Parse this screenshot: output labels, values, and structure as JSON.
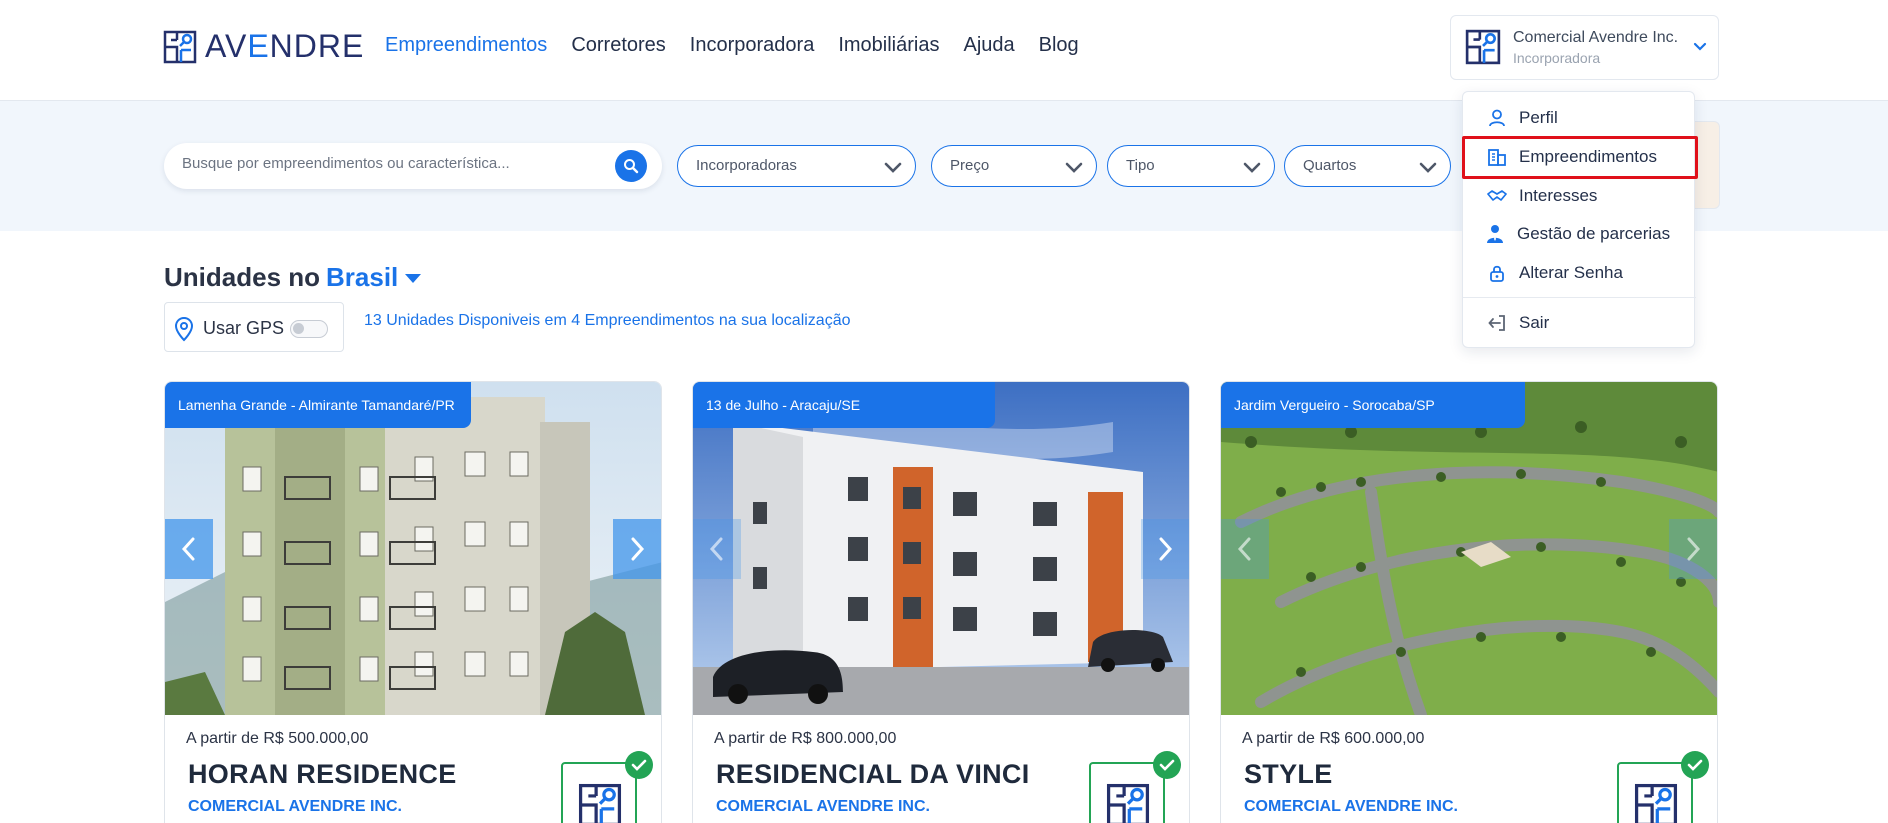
{
  "brand": {
    "logo_text_a": "AV",
    "logo_text_b": "E",
    "logo_text_c": "NDRE"
  },
  "nav": {
    "items": [
      "Empreendimentos",
      "Corretores",
      "Incorporadora",
      "Imobiliárias",
      "Ajuda",
      "Blog"
    ],
    "active_index": 0
  },
  "account": {
    "name": "Comercial Avendre Inc.",
    "role": "Incorporadora"
  },
  "dropdown": {
    "items": [
      {
        "label": "Perfil",
        "icon": "user-icon"
      },
      {
        "label": "Empreendimentos",
        "icon": "building-icon"
      },
      {
        "label": "Interesses",
        "icon": "handshake-icon"
      },
      {
        "label": "Gestão de parcerias",
        "icon": "partner-icon"
      },
      {
        "label": "Alterar Senha",
        "icon": "lock-icon"
      },
      {
        "label": "Sair",
        "icon": "logout-icon"
      }
    ],
    "highlighted_index": 1
  },
  "search": {
    "placeholder": "Busque por empreendimentos ou característica..."
  },
  "filters": [
    {
      "label": "Incorporadoras"
    },
    {
      "label": "Preço"
    },
    {
      "label": "Tipo"
    },
    {
      "label": "Quartos"
    }
  ],
  "heading": {
    "prefix": "Unidades no",
    "location": "Brasil"
  },
  "gps": {
    "label": "Usar GPS",
    "enabled": false
  },
  "summary": "13 Unidades Disponiveis em 4 Empreendimentos na sua localização",
  "cards": [
    {
      "location": "Lamenha Grande - Almirante Tamandaré/PR",
      "price": "A partir de R$ 500.000,00",
      "name": "HORAN RESIDENCE",
      "developer": "COMERCIAL AVENDRE INC."
    },
    {
      "location": "13 de Julho - Aracaju/SE",
      "price": "A partir de R$ 800.000,00",
      "name": "RESIDENCIAL DA VINCI",
      "developer": "COMERCIAL AVENDRE INC."
    },
    {
      "location": "Jardim Vergueiro - Sorocaba/SP",
      "price": "A partir de R$ 600.000,00",
      "name": "STYLE",
      "developer": "COMERCIAL AVENDRE INC."
    }
  ],
  "colors": {
    "primary": "#1a73e8",
    "navy": "#24306b",
    "verified": "#23a455",
    "highlight": "#e0101a"
  }
}
